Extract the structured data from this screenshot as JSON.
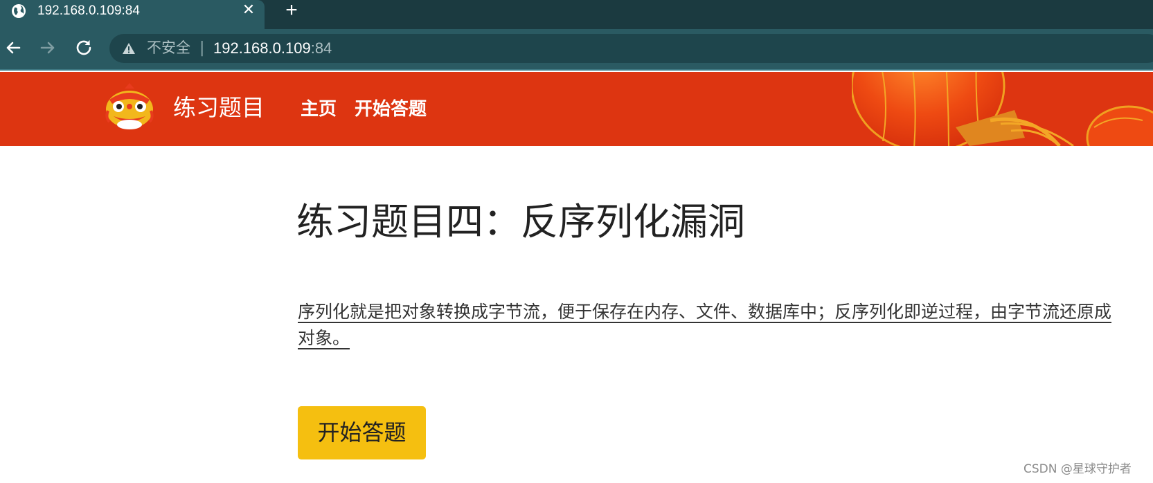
{
  "browser": {
    "tab_title": "192.168.0.109:84",
    "security_label": "不安全",
    "url_host": "192.168.0.109",
    "url_port": ":84",
    "icons": {
      "tab": "globe-icon",
      "close": "close-icon",
      "new_tab": "plus-icon",
      "back": "back-arrow-icon",
      "forward": "forward-arrow-icon",
      "reload": "reload-icon",
      "warning": "warning-icon"
    }
  },
  "site": {
    "title": "练习题目",
    "nav": [
      "主页",
      "开始答题"
    ],
    "header_color": "#dd3511"
  },
  "main": {
    "heading": "练习题目四：反序列化漏洞",
    "description": "序列化就是把对象转换成字节流，便于保存在内存、文件、数据库中；反序列化即逆过程，由字节流还原成对象。",
    "button_label": "开始答题",
    "button_color": "#f5bf10"
  },
  "watermark": "CSDN @星球守护者"
}
